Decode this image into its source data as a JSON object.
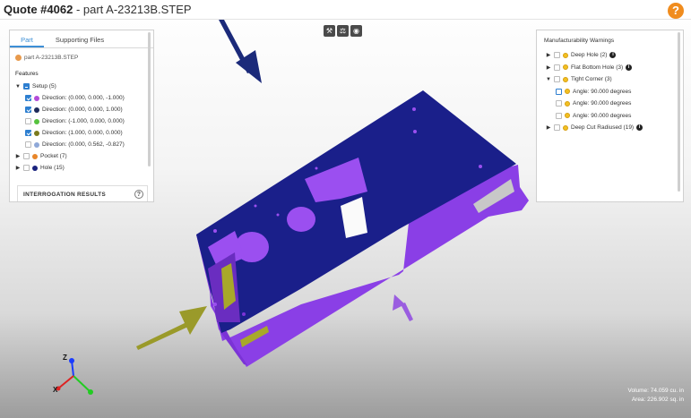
{
  "title": {
    "quote": "Quote #4062",
    "separator": " - ",
    "part": "part A-23213B.STEP"
  },
  "help": {
    "icon": "help-icon",
    "label": "?"
  },
  "toolbar": {
    "icons": [
      "hammer-icon",
      "balance-scale-icon",
      "globe-icon"
    ]
  },
  "left_panel": {
    "tabs": [
      "Part",
      "Supporting Files"
    ],
    "active_tab": "Part",
    "file_name": "part A-23213B.STEP",
    "features_label": "Features",
    "tree": [
      {
        "label": "Setup (5)",
        "state": "partial",
        "expanded": true,
        "color": "#2e7fd0",
        "children": [
          {
            "label": "Direction: (0.000, 0.000, -1.000)",
            "checked": true,
            "color": "#b44bd8"
          },
          {
            "label": "Direction: (0.000, 0.000, 1.000)",
            "checked": true,
            "color": "#1e2a5a"
          },
          {
            "label": "Direction: (-1.000, 0.000, 0.000)",
            "checked": false,
            "color": "#56c23e"
          },
          {
            "label": "Direction: (1.000, 0.000, 0.000)",
            "checked": true,
            "color": "#7a7a1e"
          },
          {
            "label": "Direction: (0.000, 0.562, -0.827)",
            "checked": false,
            "color": "#8fa8d8"
          }
        ]
      },
      {
        "label": "Pocket (7)",
        "state": "off",
        "expanded": false,
        "color": "#e8862a"
      },
      {
        "label": "Hole (15)",
        "state": "off",
        "expanded": false,
        "color": "#1a237e"
      }
    ],
    "interrogation_label": "INTERROGATION RESULTS",
    "interrogation_help": "?"
  },
  "right_panel": {
    "title": "Manufacturability Warnings",
    "items": [
      {
        "label": "Deep Hole (2)",
        "expanded": false,
        "info": true
      },
      {
        "label": "Flat Bottom Hole (3)",
        "expanded": false,
        "info": true
      },
      {
        "label": "Tight Corner (3)",
        "expanded": true,
        "info": false,
        "children": [
          "Angle: 90.000 degrees",
          "Angle: 90.000 degrees",
          "Angle: 90.000 degrees"
        ]
      },
      {
        "label": "Deep Cut Radiused (19)",
        "expanded": false,
        "info": true
      }
    ],
    "info_glyph": "i"
  },
  "stats": {
    "volume": "Volume: 74.059 cu. in",
    "area": "Area: 226.902 sq. in"
  },
  "axes": {
    "z": "Z",
    "x": "X"
  },
  "colors": {
    "part_top": "#1a1f8a",
    "part_side": "#8a3fe6",
    "accent": "#3d8fd6",
    "warning": "#f2c023",
    "help": "#f08c1e",
    "arrow_down": "#1b2a7a",
    "arrow_olive": "#9a9a2a",
    "arrow_purple": "#9a5de0"
  }
}
